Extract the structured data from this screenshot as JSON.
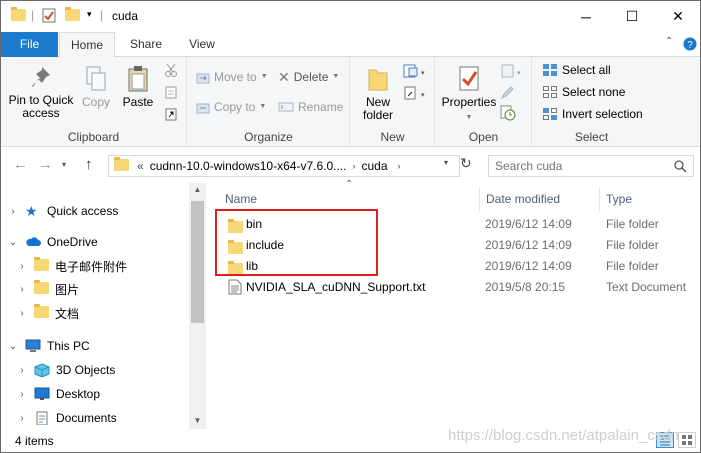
{
  "window": {
    "title": "cuda",
    "controls": {
      "minimize": "─",
      "maximize": "☐",
      "close": "✕"
    }
  },
  "ribbon_tabs": [
    {
      "label": "File",
      "active": false
    },
    {
      "label": "Home",
      "active": true
    },
    {
      "label": "Share",
      "active": false
    },
    {
      "label": "View",
      "active": false
    }
  ],
  "ribbon": {
    "clipboard": {
      "label": "Clipboard",
      "pin_label_1": "Pin to Quick",
      "pin_label_2": "access",
      "copy": "Copy",
      "paste": "Paste"
    },
    "organize": {
      "label": "Organize",
      "move_to": "Move to",
      "copy_to": "Copy to",
      "delete": "Delete",
      "rename": "Rename"
    },
    "new": {
      "label": "New",
      "new_folder_1": "New",
      "new_folder_2": "folder"
    },
    "open": {
      "label": "Open",
      "properties": "Properties"
    },
    "select": {
      "label": "Select",
      "select_all": "Select all",
      "select_none": "Select none",
      "invert_selection": "Invert selection"
    }
  },
  "address": {
    "overflow": "«",
    "path": [
      "cudnn-10.0-windows10-x64-v7.6.0....",
      "cuda"
    ],
    "search_placeholder": "Search cuda"
  },
  "nav_pane": [
    {
      "label": "Quick access",
      "icon": "star-icon",
      "expanded": false,
      "level": 0
    },
    {
      "label": "OneDrive",
      "icon": "cloud-icon",
      "expanded": true,
      "level": 0
    },
    {
      "label": "电子邮件附件",
      "icon": "folder-icon",
      "expanded": false,
      "level": 1
    },
    {
      "label": "图片",
      "icon": "folder-icon",
      "expanded": false,
      "level": 1
    },
    {
      "label": "文档",
      "icon": "folder-icon",
      "expanded": false,
      "level": 1
    },
    {
      "label": "This PC",
      "icon": "computer-icon",
      "expanded": true,
      "level": 0
    },
    {
      "label": "3D Objects",
      "icon": "cube-icon",
      "expanded": false,
      "level": 1
    },
    {
      "label": "Desktop",
      "icon": "desktop-icon",
      "expanded": false,
      "level": 1
    },
    {
      "label": "Documents",
      "icon": "documents-icon",
      "expanded": false,
      "level": 1
    }
  ],
  "columns": {
    "name": "Name",
    "date_modified": "Date modified",
    "type": "Type"
  },
  "files": [
    {
      "name": "bin",
      "date": "2019/6/12 14:09",
      "type": "File folder",
      "icon": "folder-icon"
    },
    {
      "name": "include",
      "date": "2019/6/12 14:09",
      "type": "File folder",
      "icon": "folder-icon"
    },
    {
      "name": "lib",
      "date": "2019/6/12 14:09",
      "type": "File folder",
      "icon": "folder-icon"
    },
    {
      "name": "NVIDIA_SLA_cuDNN_Support.txt",
      "date": "2019/5/8 20:15",
      "type": "Text Document",
      "icon": "text-file-icon"
    }
  ],
  "status": {
    "item_count": "4 items"
  },
  "watermark": "https://blog.csdn.net/atpalain_csdn",
  "colors": {
    "file_tab": "#1979ca",
    "folder": "#f8d775",
    "highlight_box": "#e01e1e",
    "column_header": "#4c607a"
  }
}
